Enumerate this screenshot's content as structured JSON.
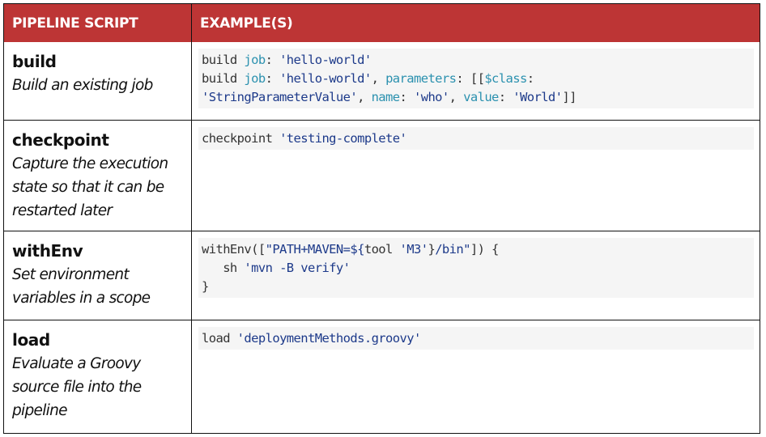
{
  "header": {
    "col1": "PIPELINE SCRIPT",
    "col2": "EXAMPLE(S)"
  },
  "colors": {
    "header_bg": "#bd3535",
    "header_text": "#ffffff",
    "code_bg": "#f5f5f5",
    "code_keyword": "#2b91af",
    "code_string": "#1d3a8a",
    "code_plain": "#333333"
  },
  "rows": [
    {
      "name": "build",
      "description": "Build an existing job",
      "description_lines": [
        "Build an existing job"
      ],
      "code_lines": [
        [
          {
            "t": "plain",
            "v": "build "
          },
          {
            "t": "kw",
            "v": "job"
          },
          {
            "t": "plain",
            "v": ": "
          },
          {
            "t": "str",
            "v": "'hello-world'"
          }
        ],
        [
          {
            "t": "plain",
            "v": "build "
          },
          {
            "t": "kw",
            "v": "job"
          },
          {
            "t": "plain",
            "v": ": "
          },
          {
            "t": "str",
            "v": "'hello-world'"
          },
          {
            "t": "plain",
            "v": ", "
          },
          {
            "t": "kw",
            "v": "parameters"
          },
          {
            "t": "plain",
            "v": ": [["
          },
          {
            "t": "kw",
            "v": "$class"
          },
          {
            "t": "plain",
            "v": ":"
          }
        ],
        [
          {
            "t": "str",
            "v": "'StringParameterValue'"
          },
          {
            "t": "plain",
            "v": ", "
          },
          {
            "t": "kw",
            "v": "name"
          },
          {
            "t": "plain",
            "v": ": "
          },
          {
            "t": "str",
            "v": "'who'"
          },
          {
            "t": "plain",
            "v": ", "
          },
          {
            "t": "kw",
            "v": "value"
          },
          {
            "t": "plain",
            "v": ": "
          },
          {
            "t": "str",
            "v": "'World'"
          },
          {
            "t": "plain",
            "v": "]]"
          }
        ]
      ]
    },
    {
      "name": "checkpoint",
      "description": "Capture the execution state so that it can be restarted later",
      "description_lines": [
        "Capture the execution",
        "state so that it can be",
        "restarted later"
      ],
      "code_lines": [
        [
          {
            "t": "plain",
            "v": "checkpoint "
          },
          {
            "t": "str",
            "v": "'testing-complete'"
          }
        ]
      ]
    },
    {
      "name": "withEnv",
      "description": "Set environment variables in a scope",
      "description_lines": [
        "Set environment",
        "variables in a scope"
      ],
      "code_lines": [
        [
          {
            "t": "plain",
            "v": "withEnv(["
          },
          {
            "t": "str",
            "v": "\"PATH+MAVEN=${"
          },
          {
            "t": "plain",
            "v": "tool "
          },
          {
            "t": "str",
            "v": "'M3'"
          },
          {
            "t": "plain",
            "v": "}"
          },
          {
            "t": "str",
            "v": "/bin\""
          },
          {
            "t": "plain",
            "v": "]) {"
          }
        ],
        [
          {
            "t": "plain",
            "v": "   sh "
          },
          {
            "t": "str",
            "v": "'mvn -B verify'"
          }
        ],
        [
          {
            "t": "plain",
            "v": "}"
          }
        ]
      ]
    },
    {
      "name": "load",
      "description": "Evaluate a Groovy source file into the pipeline",
      "description_lines": [
        "Evaluate a Groovy",
        "source file into the",
        "pipeline"
      ],
      "code_lines": [
        [
          {
            "t": "plain",
            "v": "load "
          },
          {
            "t": "str",
            "v": "'deploymentMethods.groovy'"
          }
        ]
      ]
    }
  ]
}
